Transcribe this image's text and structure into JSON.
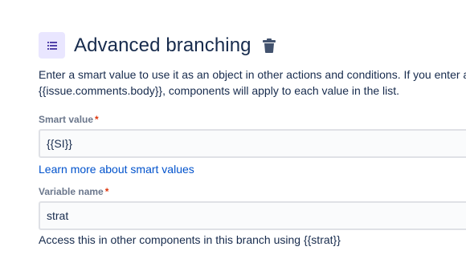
{
  "header": {
    "icon": "branch-list-icon",
    "title": "Advanced branching",
    "delete_icon": "trash-icon"
  },
  "description": {
    "line1": "Enter a smart value to use it as an object in other actions and conditions. If you enter a",
    "line2": "{{issue.comments.body}}, components will apply to each value in the list."
  },
  "smart_value": {
    "label": "Smart value",
    "required_marker": "*",
    "value": "{{SI}}"
  },
  "learn_more_link": "Learn more about smart values",
  "variable_name": {
    "label": "Variable name",
    "required_marker": "*",
    "value": "strat"
  },
  "help_text": "Access this in other components in this branch using {{strat}}",
  "colors": {
    "accent_bg": "#e9e6ff",
    "accent_icon": "#5243aa",
    "link": "#0052cc",
    "required": "#de350b"
  }
}
